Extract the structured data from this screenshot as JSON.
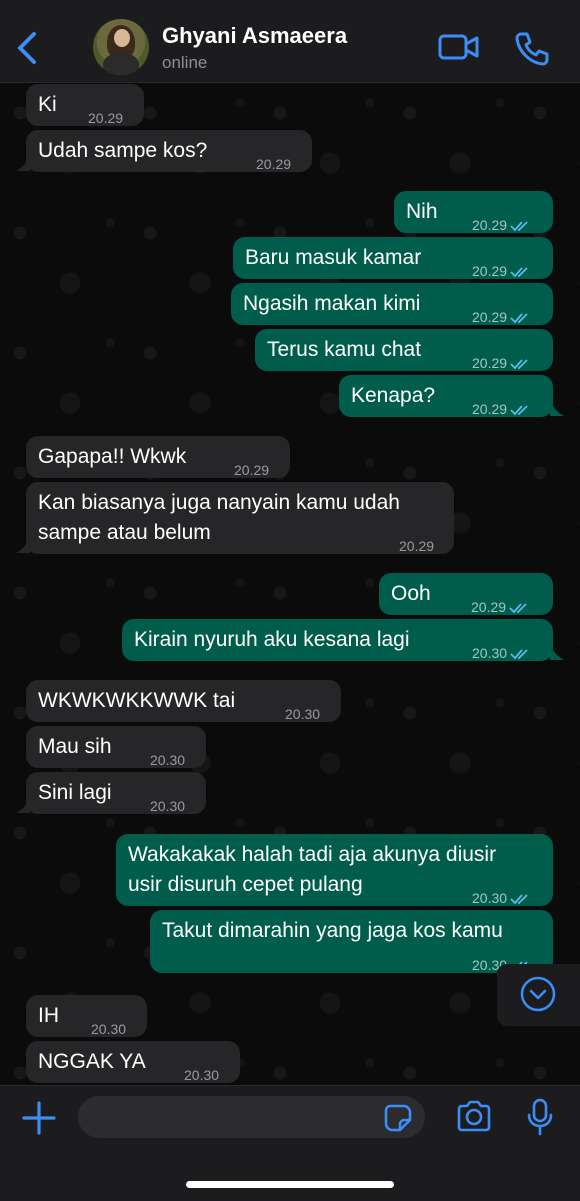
{
  "header": {
    "contact_name": "Ghyani Asmaeera",
    "status": "online"
  },
  "colors": {
    "accent": "#3a8ef6",
    "incoming_bubble": "#262628",
    "outgoing_bubble": "#005c4b",
    "read_check": "#53bdeb"
  },
  "messages": [
    {
      "dir": "in",
      "text": "Ki",
      "time": "20.29"
    },
    {
      "dir": "in",
      "text": "Udah sampe kos?",
      "time": "20.29"
    },
    {
      "dir": "out",
      "text": "Nih",
      "time": "20.29",
      "read": true
    },
    {
      "dir": "out",
      "text": "Baru masuk kamar",
      "time": "20.29",
      "read": true
    },
    {
      "dir": "out",
      "text": "Ngasih makan kimi",
      "time": "20.29",
      "read": true
    },
    {
      "dir": "out",
      "text": "Terus kamu chat",
      "time": "20.29",
      "read": true
    },
    {
      "dir": "out",
      "text": "Kenapa?",
      "time": "20.29",
      "read": true
    },
    {
      "dir": "in",
      "text": "Gapapa!! Wkwk",
      "time": "20.29"
    },
    {
      "dir": "in",
      "text": "Kan biasanya juga nanyain kamu udah sampe atau belum",
      "line1": "Kan biasanya juga nanyain kamu udah",
      "line2": "sampe atau belum",
      "time": "20.29"
    },
    {
      "dir": "out",
      "text": "Ooh",
      "time": "20.29",
      "read": true
    },
    {
      "dir": "out",
      "text": "Kirain nyuruh aku kesana lagi",
      "time": "20.30",
      "read": true
    },
    {
      "dir": "in",
      "text": "WKWKWKKWWK tai",
      "time": "20.30"
    },
    {
      "dir": "in",
      "text": "Mau sih",
      "time": "20.30"
    },
    {
      "dir": "in",
      "text": "Sini lagi",
      "time": "20.30"
    },
    {
      "dir": "out",
      "text": "Wakakakak halah tadi aja akunya diusir usir disuruh cepet pulang",
      "line1": "Wakakakak halah tadi aja akunya diusir",
      "line2": "usir disuruh cepet pulang",
      "time": "20.30",
      "read": true
    },
    {
      "dir": "out",
      "text": "Takut dimarahin yang jaga kos kamu",
      "time": "20.30",
      "read": true
    },
    {
      "dir": "in",
      "text": "IH",
      "time": "20.30"
    },
    {
      "dir": "in",
      "text": "NGGAK YA",
      "time": "20.30"
    }
  ],
  "icons": {
    "back": "chevron-left-icon",
    "video": "video-camera-icon",
    "call": "phone-icon",
    "scroll_down": "chevron-down-circle-icon",
    "attach": "plus-icon",
    "sticker": "sticker-icon",
    "camera": "camera-icon",
    "mic": "microphone-icon"
  }
}
